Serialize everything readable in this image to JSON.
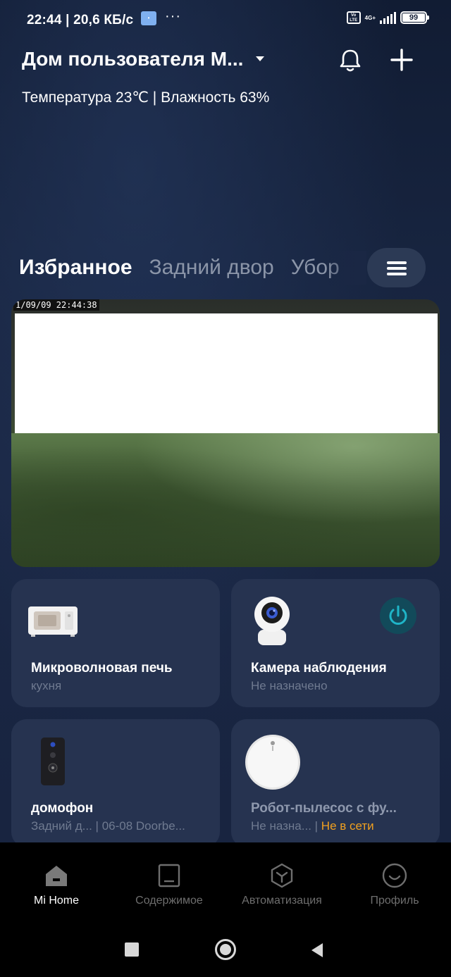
{
  "status_bar": {
    "time": "22:44",
    "separator": "|",
    "speed": "20,6 КБ/с",
    "dots": "···",
    "network": "4G+",
    "volte": "Vo LTE",
    "battery": "99"
  },
  "header": {
    "home_name": "Дом пользователя М...",
    "climate": "Температура 23℃ | Влажность 63%"
  },
  "tabs": [
    {
      "label": "Избранное",
      "active": true
    },
    {
      "label": "Задний двор",
      "active": false
    },
    {
      "label": "Убор",
      "active": false
    }
  ],
  "camera_feed": {
    "timestamp": "1/09/09  22:44:38"
  },
  "devices": [
    {
      "name": "Микроволновая печь",
      "room": "кухня"
    },
    {
      "name": "Камера наблюдения",
      "room": "Не назначено"
    },
    {
      "name": "домофон",
      "room": "Задний д... | 06-08 Doorbe..."
    },
    {
      "name": "Робот-пылесос с фу...",
      "room": "Не назна...",
      "status": "Не в сети"
    }
  ],
  "bottom_nav": [
    {
      "label": "Mi Home",
      "icon": "home-icon",
      "active": true
    },
    {
      "label": "Содержимое",
      "icon": "content-icon",
      "active": false
    },
    {
      "label": "Автоматизация",
      "icon": "automation-icon",
      "active": false
    },
    {
      "label": "Профиль",
      "icon": "profile-icon",
      "active": false
    }
  ],
  "colors": {
    "background": "#162038",
    "card": "#263350",
    "accent_offline": "#f0a020",
    "power_accent": "#1fb5c8"
  }
}
